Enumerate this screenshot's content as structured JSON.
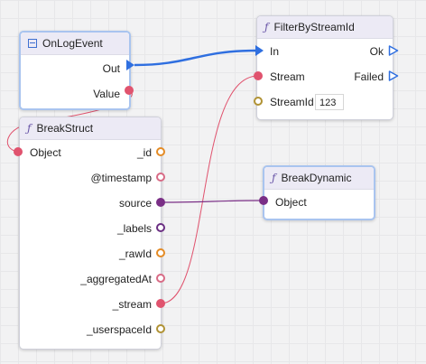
{
  "nodes": {
    "on_log_event": {
      "title": "OnLogEvent",
      "icon": "event-icon",
      "outputs": {
        "out": "Out",
        "value": "Value"
      }
    },
    "filter_by_stream_id": {
      "title": "FilterByStreamId",
      "icon": "function-icon",
      "inputs": {
        "in": "In",
        "stream": "Stream",
        "stream_id": "StreamId"
      },
      "outputs": {
        "ok": "Ok",
        "failed": "Failed"
      },
      "stream_id_value": "123"
    },
    "break_struct": {
      "title": "BreakStruct",
      "icon": "function-icon",
      "input": "Object",
      "outputs": [
        "_id",
        "@timestamp",
        "source",
        "_labels",
        "_rawId",
        "_aggregatedAt",
        "_stream",
        "_userspaceId"
      ]
    },
    "break_dynamic": {
      "title": "BreakDynamic",
      "icon": "function-icon",
      "input": "Object"
    }
  },
  "colors": {
    "exec_wire": "#2f6fe0",
    "stream_wire": "#e0536e",
    "source_wire": "#7a2f86",
    "header_bg": "#eceaf5",
    "selected_border": "#a9c4ef"
  }
}
